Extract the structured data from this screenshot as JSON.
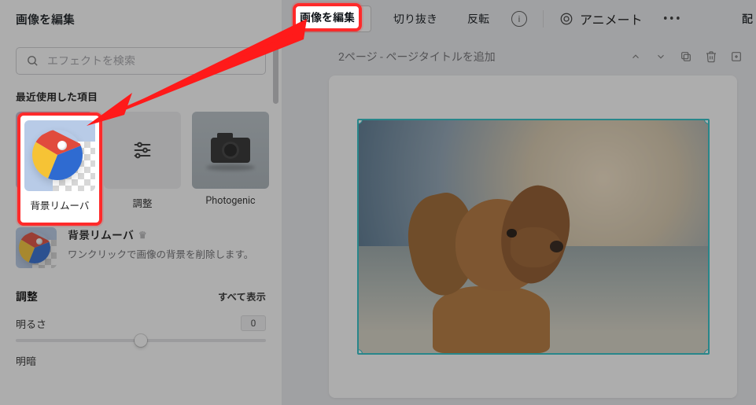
{
  "topbar": {
    "left_title": "画像を編集",
    "edit_image": "画像を編集",
    "crop": "切り抜き",
    "flip": "反転",
    "animate": "アニメート",
    "more": "•••",
    "align_right": "配"
  },
  "search": {
    "placeholder": "エフェクトを検索"
  },
  "recent": {
    "title": "最近使用した項目",
    "items": [
      {
        "label": "背景リムーバ",
        "icon": "beachball"
      },
      {
        "label": "調整",
        "icon": "adjust"
      },
      {
        "label": "Photogenic",
        "icon": "camera"
      }
    ]
  },
  "feature": {
    "title": "背景リムーバ",
    "desc": "ワンクリックで画像の背景を削除します。"
  },
  "adjust": {
    "title": "調整",
    "show_all": "すべて表示",
    "brightness_label": "明るさ",
    "brightness_value": "0",
    "contrast_label": "明暗"
  },
  "page": {
    "title": "2ページ - ページタイトルを追加"
  },
  "highlights": {
    "btn": "画像を編集",
    "tile": "背景リムーバ"
  }
}
